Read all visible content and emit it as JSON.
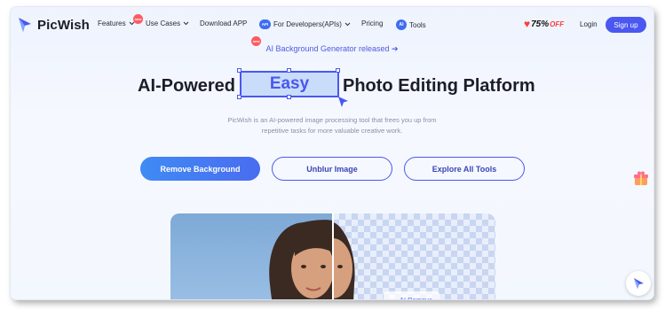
{
  "brand": {
    "name": "PicWish",
    "accent": "#4a57f0"
  },
  "nav": {
    "features": "Features",
    "new_badge": "new",
    "use_cases": "Use Cases",
    "download": "Download APP",
    "api_badge": "API",
    "developers": "For Developers(APIs)",
    "pricing": "Pricing",
    "tools_badge": "AI",
    "tools": "Tools",
    "promo_percent": "75%",
    "promo_off": "OFF",
    "login": "Login",
    "signup": "Sign up"
  },
  "hero": {
    "announcement": "AI Background Generator released ➔",
    "title_before": "AI-Powered",
    "title_highlight": "Easy",
    "title_after": "Photo Editing Platform",
    "subtitle_line1": "PicWish is an AI-powered image processing tool that frees you up from",
    "subtitle_line2": "repetitive tasks for more valuable creative work."
  },
  "buttons": {
    "remove_bg": "Remove Background",
    "unblur": "Unblur Image",
    "explore": "Explore All Tools"
  },
  "demo": {
    "tag": "AI Remove"
  },
  "icons": [
    "picwish-logo-icon",
    "chevron-down-icon",
    "api-icon",
    "tools-icon",
    "heart-icon",
    "cursor-icon",
    "gift-icon",
    "chat-icon"
  ]
}
